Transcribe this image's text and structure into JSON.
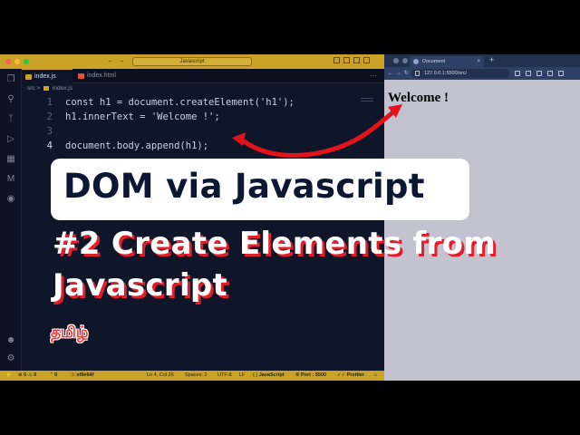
{
  "vscode": {
    "search_label": "Javascript",
    "tabs": [
      {
        "label": "index.js",
        "active": true
      },
      {
        "label": "index.html",
        "active": false
      }
    ],
    "breadcrumb": {
      "folder": "src",
      "file": "index.js"
    },
    "code_lines": [
      {
        "number": "1",
        "text": "const h1 = document.createElement('h1');"
      },
      {
        "number": "2",
        "text": "h1.innerText = 'Welcome !';"
      },
      {
        "number": "3",
        "text": ""
      },
      {
        "number": "4",
        "text": "document.body.append(h1);"
      }
    ],
    "statusbar": {
      "errors": "0",
      "warnings": "0",
      "ports": "0",
      "branch": "ef9e64f",
      "position": "Ln 4, Col 26",
      "spaces": "Spaces: 2",
      "encoding": "UTF-8",
      "eol": "LF",
      "language": "JavaScript",
      "port": "Port : 5500",
      "formatter": "Prettier"
    },
    "accent_color": "#c9a227"
  },
  "browser": {
    "tab_title": "Document",
    "url": "127.0.0.1:5500/src/",
    "heading": "Welcome !"
  },
  "overlay": {
    "title": "DOM via Javascript",
    "subtitle_line1": "#2  Create Elements from",
    "subtitle_line2": "Javascript",
    "language_tag": "தமிழ்",
    "arrow_color": "#e3121b"
  }
}
